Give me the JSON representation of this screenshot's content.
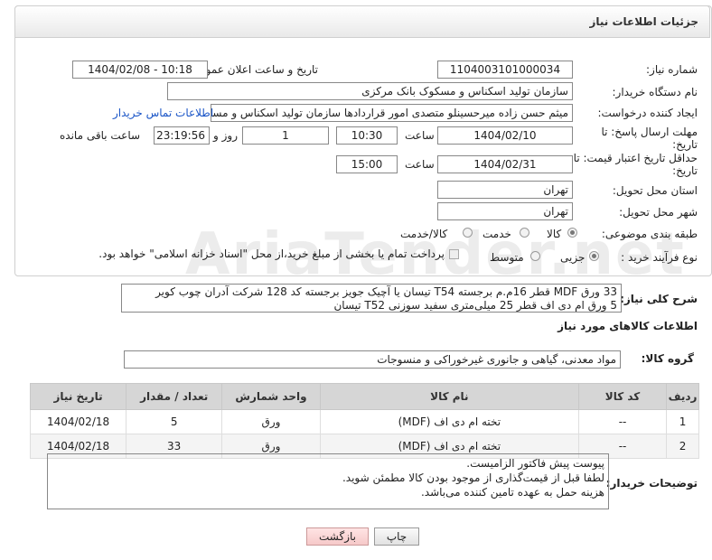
{
  "header": {
    "title": "جزئیات اطلاعات نیاز"
  },
  "fields": {
    "need_number_label": "شماره نیاز:",
    "need_number": "1104003101000034",
    "announce_label": "تاریخ و ساعت اعلان عمومی:",
    "announce_value": "1404/02/08 - 10:18",
    "buyer_label": "نام دستگاه خریدار:",
    "buyer_value": "سازمان تولید اسکناس و مسکوک بانک مرکزی",
    "creator_label": "ایجاد کننده درخواست:",
    "creator_value": "میثم حسن زاده میرحسینلو متصدی امور قراردادها سازمان تولید اسکناس و مسکوک بانک مرکزی",
    "contact_link": "اطلاعات تماس خریدار",
    "deadline_label": "مهلت ارسال پاسخ: تا تاریخ:",
    "deadline_date": "1404/02/10",
    "time_label": "ساعت",
    "deadline_time": "10:30",
    "days_value": "1",
    "days_label": "روز و",
    "remaining_time": "23:19:56",
    "remaining_label": "ساعت باقی مانده",
    "validity_label": "حداقل تاریخ اعتبار قیمت: تا تاریخ:",
    "validity_date": "1404/02/31",
    "validity_time": "15:00",
    "province_label": "استان محل تحویل:",
    "province_value": "تهران",
    "city_label": "شهر محل تحویل:",
    "city_value": "تهران",
    "category_label": "طبقه بندی موضوعی:",
    "category_options": [
      "کالا",
      "خدمت",
      "کالا/خدمت"
    ],
    "process_label": "نوع فرآیند خرید :",
    "process_options": [
      "جزیی",
      "متوسط"
    ],
    "payment_note": "پرداخت تمام یا بخشی از مبلغ خرید،از محل \"اسناد خزانه اسلامی\" خواهد بود."
  },
  "description": {
    "label": "شرح کلی نیاز:",
    "line1": "33 ورق MDF قطر 16م.م برجسته T54 تیسان یا آچیک جویز برجسته کد 128 شرکت آدران چوب کویر",
    "line2": "5 ورق ام دی اف قطر 25 میلی‌متری سفید سوزنی T52 تیسان"
  },
  "goods_section": {
    "title": "اطلاعات کالاهای مورد نیاز",
    "group_label": "گروه کالا:",
    "group_value": "مواد معدنی، گیاهی و جانوری غیرخوراکی و منسوجات"
  },
  "table": {
    "headers": [
      "ردیف",
      "کد کالا",
      "نام کالا",
      "واحد شمارش",
      "تعداد / مقدار",
      "تاریخ نیاز"
    ],
    "rows": [
      [
        "1",
        "--",
        "تخته ام دی اف (MDF)",
        "ورق",
        "5",
        "1404/02/18"
      ],
      [
        "2",
        "--",
        "تخته ام دی اف (MDF)",
        "ورق",
        "33",
        "1404/02/18"
      ]
    ]
  },
  "notes": {
    "label": "توضیحات خریدار:",
    "line1": "پیوست پیش فاکتور الزامیست.",
    "line2": "لطفا قبل از قیمت‌گذاری از موجود بودن کالا مطمئن شوید.",
    "line3": "هزینه حمل به عهده تامین کننده می‌باشد."
  },
  "buttons": {
    "print": "چاپ",
    "back": "بازگشت"
  }
}
